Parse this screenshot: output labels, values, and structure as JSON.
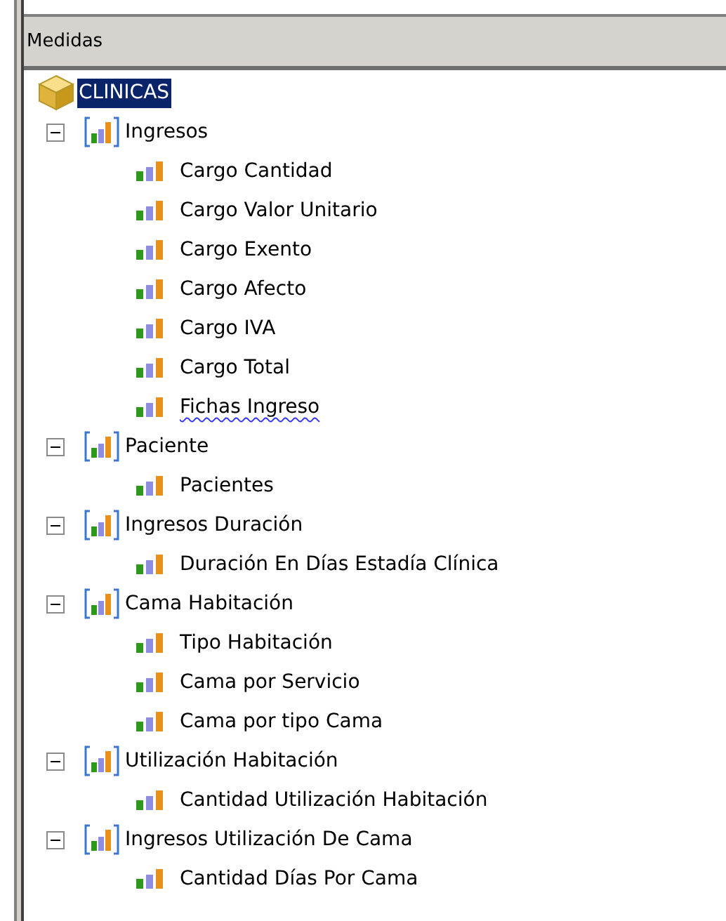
{
  "panel": {
    "title": "Medidas"
  },
  "tree": {
    "root": {
      "label": "CLINICAS",
      "selected": true,
      "children": [
        {
          "label": "Ingresos",
          "expanded": true,
          "children": [
            {
              "label": "Cargo Cantidad",
              "misspelled": false
            },
            {
              "label": "Cargo Valor Unitario",
              "misspelled": false
            },
            {
              "label": "Cargo Exento",
              "misspelled": false
            },
            {
              "label": "Cargo Afecto",
              "misspelled": false
            },
            {
              "label": "Cargo IVA",
              "misspelled": false
            },
            {
              "label": "Cargo Total",
              "misspelled": false
            },
            {
              "label": "Fichas Ingreso",
              "misspelled": true
            }
          ]
        },
        {
          "label": "Paciente",
          "expanded": true,
          "children": [
            {
              "label": "Pacientes",
              "misspelled": false
            }
          ]
        },
        {
          "label": "Ingresos Duración",
          "expanded": true,
          "children": [
            {
              "label": "Duración En Días Estadía Clínica",
              "misspelled": false
            }
          ]
        },
        {
          "label": "Cama Habitación",
          "expanded": true,
          "children": [
            {
              "label": "Tipo Habitación",
              "misspelled": false
            },
            {
              "label": "Cama por Servicio",
              "misspelled": false
            },
            {
              "label": "Cama por tipo Cama",
              "misspelled": false
            }
          ]
        },
        {
          "label": "Utilización Habitación",
          "expanded": true,
          "children": [
            {
              "label": "Cantidad Utilización Habitación",
              "misspelled": false
            }
          ]
        },
        {
          "label": "Ingresos Utilización De Cama",
          "expanded": true,
          "children": [
            {
              "label": "Cantidad Días Por Cama",
              "misspelled": false
            }
          ]
        }
      ]
    }
  }
}
